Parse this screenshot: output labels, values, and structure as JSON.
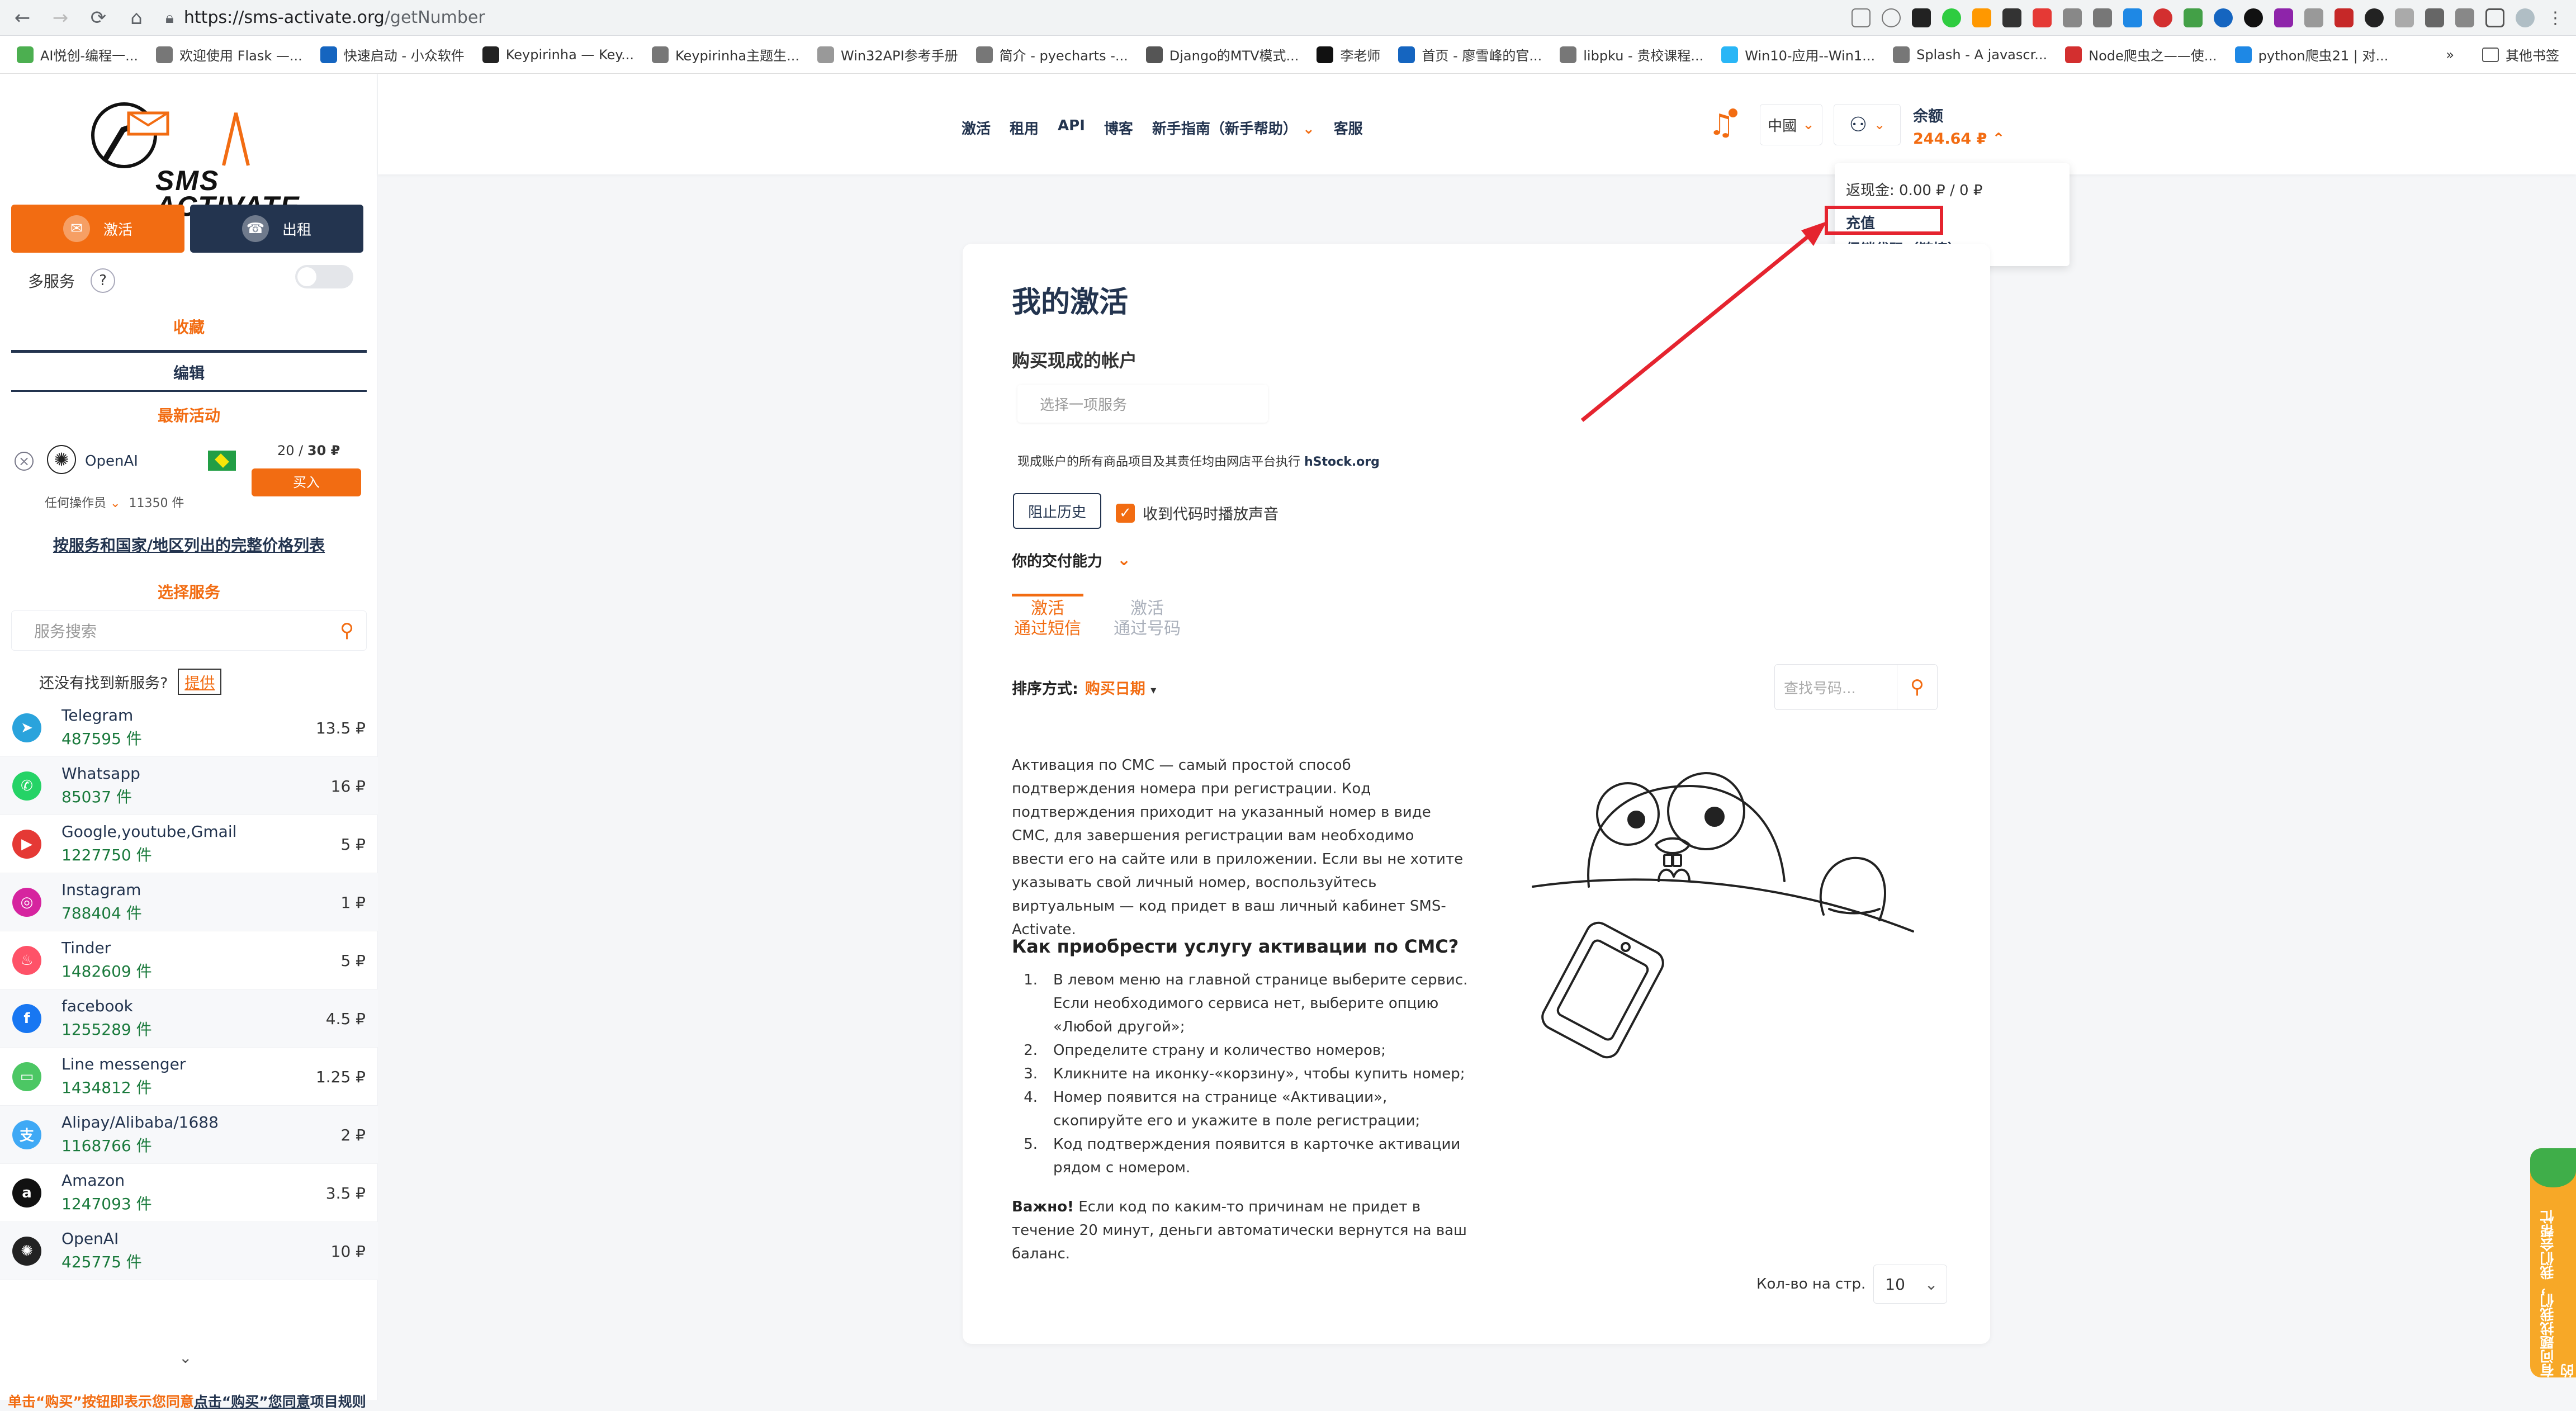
{
  "browser": {
    "url_host": "https://sms-activate.org",
    "url_path": "/getNumber",
    "bookmarks": [
      {
        "label": "AI悦创-编程一...",
        "color": "#4caf50"
      },
      {
        "label": "欢迎使用 Flask —...",
        "color": "#777777"
      },
      {
        "label": "快速启动 - 小众软件",
        "color": "#1565c0"
      },
      {
        "label": "Keypirinha — Key...",
        "color": "#222222"
      },
      {
        "label": "Keypirinha主题生...",
        "color": "#777777"
      },
      {
        "label": "Win32API参考手册",
        "color": "#999999"
      },
      {
        "label": "简介 - pyecharts -...",
        "color": "#777777"
      },
      {
        "label": "Django的MTV模式...",
        "color": "#555555"
      },
      {
        "label": "李老师",
        "color": "#111111"
      },
      {
        "label": "首页 - 廖雪峰的官...",
        "color": "#1565c0"
      },
      {
        "label": "libpku - 贵校课程...",
        "color": "#777777"
      },
      {
        "label": "Win10-应用--Win1...",
        "color": "#29b6f6"
      },
      {
        "label": "Splash - A javascr...",
        "color": "#777777"
      },
      {
        "label": "Node爬虫之——使...",
        "color": "#d32f2f"
      },
      {
        "label": "python爬虫21 | 对...",
        "color": "#1e88e5"
      }
    ],
    "bookmarks_more": "»",
    "other_bookmarks": "其他书签"
  },
  "sidebar": {
    "logo_line1": "SMS",
    "logo_line2": "ACTIVATE",
    "activate_btn": "激活",
    "rent_btn": "出租",
    "multi_service": "多服务",
    "help": "?",
    "favorites": "收藏",
    "edit": "编辑",
    "latest_activity": "最新活动",
    "activity": {
      "service": "OpenAI",
      "price_current": "20",
      "price_total": "30 ₽",
      "buy": "买入",
      "operator": "任何操作员",
      "count": "11350 件"
    },
    "full_price_link": "按服务和国家/地区列出的完整价格列表",
    "select_service": "选择服务",
    "search_placeholder": "服务搜索",
    "not_found": "还没有找到新服务?",
    "provide": "提供",
    "services": [
      {
        "name": "Telegram",
        "count": "487595 件",
        "price": "13.5 ₽",
        "icon": "telegram-icon",
        "color": "#2aa3dc",
        "glyph": "➤"
      },
      {
        "name": "Whatsapp",
        "count": "85037 件",
        "price": "16 ₽",
        "icon": "whatsapp-icon",
        "color": "#25d366",
        "glyph": "✆"
      },
      {
        "name": "Google,youtube,Gmail",
        "count": "1227750 件",
        "price": "5 ₽",
        "icon": "youtube-icon",
        "color": "#e53935",
        "glyph": "▶"
      },
      {
        "name": "Instagram",
        "count": "788404 件",
        "price": "1 ₽",
        "icon": "instagram-icon",
        "color": "#d6249f",
        "glyph": "◎"
      },
      {
        "name": "Tinder",
        "count": "1482609 件",
        "price": "5 ₽",
        "icon": "tinder-icon",
        "color": "#fe5268",
        "glyph": "♨"
      },
      {
        "name": "facebook",
        "count": "1255289 件",
        "price": "4.5 ₽",
        "icon": "facebook-icon",
        "color": "#1877f2",
        "glyph": "f"
      },
      {
        "name": "Line messenger",
        "count": "1434812 件",
        "price": "1.25 ₽",
        "icon": "line-icon",
        "color": "#4cc764",
        "glyph": "▭"
      },
      {
        "name": "Alipay/Alibaba/1688",
        "count": "1168766 件",
        "price": "2 ₽",
        "icon": "alipay-icon",
        "color": "#3fa9f5",
        "glyph": "支"
      },
      {
        "name": "Amazon",
        "count": "1247093 件",
        "price": "3.5 ₽",
        "icon": "amazon-icon",
        "color": "#111111",
        "glyph": "a"
      },
      {
        "name": "OpenAI",
        "count": "425775 件",
        "price": "10 ₽",
        "icon": "openai-icon",
        "color": "#222222",
        "glyph": "✺"
      }
    ],
    "terms_prefix": "单击“购买”按钮即表示您同意",
    "terms_link": "点击“购买”您同意",
    "terms_suffix": "项目规则"
  },
  "header": {
    "nav": [
      {
        "label": "激活"
      },
      {
        "label": "租用"
      },
      {
        "label": "API"
      },
      {
        "label": "博客"
      },
      {
        "label": "新手指南（新手帮助）"
      },
      {
        "label": "客服"
      }
    ],
    "language": "中國",
    "balance_label": "余额",
    "balance_amount": "244.64 ₽",
    "dropdown": {
      "cashback": "返现金: 0.00 ₽ / 0 ₽",
      "topup": "充值",
      "promo": "促销代码（链接）"
    }
  },
  "main": {
    "title": "我的激活",
    "buy_accounts": "购买现成的帐户",
    "select_service_placeholder": "选择一项服务",
    "hstock_note": "现成账户的所有商品项目及其责任均由网店平台执行",
    "hstock_link": "hStock.org",
    "block_history": "阻止历史",
    "sound_checkbox": "收到代码时播放声音",
    "payment_ability": "你的交付能力",
    "tab_sms_line1": "激活",
    "tab_sms_line2": "通过短信",
    "tab_number_line1": "激活",
    "tab_number_line2": "通过号码",
    "sort_label": "排序方式:",
    "sort_value": "购买日期",
    "phone_search_placeholder": "查找号码...",
    "description": "Активация по СМС — самый простой способ подтверждения номера при регистрации. Код подтверждения приходит на указанный номер в виде СМС, для завершения регистрации вам необходимо ввести его на сайте или в приложении. Если вы не хотите указывать свой личный номер, воспользуйтесь виртуальным — код придет в ваш личный кабинет SMS-Activate.",
    "howto_title": "Как приобрести услугу активации по СМС?",
    "steps": [
      "В левом меню на главной странице выберите сервис. Если необходимого сервиса нет, выберите опцию «Любой другой»;",
      "Определите страну и количество номеров;",
      "Кликните на иконку-«корзину», чтобы купить номер;",
      "Номер появится на странице «Активации», скопируйте его и укажите в поле регистрации;",
      "Код подтверждения появится в карточке активации рядом с номером."
    ],
    "important_label": "Важно!",
    "important_text": "Если код по каким-то причинам не придет в течение 20 минут, деньги автоматически вернутся на ваш баланс.",
    "per_page_label": "Кол-во на стр.",
    "per_page_value": "10"
  },
  "side_widget": "有问题找我们，我们会帮忙的",
  "colors": {
    "accent": "#f26c12",
    "navy": "#23344f",
    "highlight": "#e5242f"
  }
}
